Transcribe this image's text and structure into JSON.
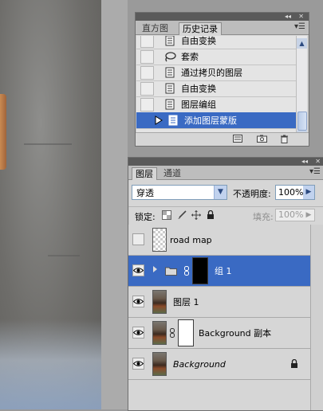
{
  "history_panel": {
    "tabs": [
      "直方图",
      "历史记录"
    ],
    "active_tab": "历史记录",
    "items": [
      {
        "label": "自由变换",
        "icon": "history-state-icon",
        "selected": false
      },
      {
        "label": "套索",
        "icon": "lasso-icon",
        "selected": false
      },
      {
        "label": "通过拷贝的图层",
        "icon": "history-state-icon",
        "selected": false
      },
      {
        "label": "自由变换",
        "icon": "history-state-icon",
        "selected": false
      },
      {
        "label": "图层编组",
        "icon": "history-state-icon",
        "selected": false
      },
      {
        "label": "添加图层蒙版",
        "icon": "history-state-icon",
        "selected": true
      }
    ]
  },
  "layers_panel": {
    "tabs": [
      "图层",
      "通道"
    ],
    "active_tab": "图层",
    "blend_mode": "穿透",
    "opacity_label": "不透明度:",
    "opacity_value": "100%",
    "lock_label": "锁定:",
    "fill_label": "填充:",
    "fill_value": "100%",
    "layers": [
      {
        "name": "road map",
        "visible": false,
        "type": "transparent",
        "selected": false
      },
      {
        "name": "组 1",
        "visible": true,
        "type": "group",
        "selected": true
      },
      {
        "name": "图层 1",
        "visible": true,
        "type": "photo",
        "selected": false
      },
      {
        "name": "Background 副本",
        "visible": true,
        "type": "masked",
        "selected": false
      },
      {
        "name": "Background",
        "visible": true,
        "type": "background",
        "selected": false,
        "locked": true
      }
    ]
  },
  "colors": {
    "selection": "#3a6ac3",
    "panel_bg": "#d6d6d6",
    "panel_titlebar": "#5a5a5a"
  }
}
